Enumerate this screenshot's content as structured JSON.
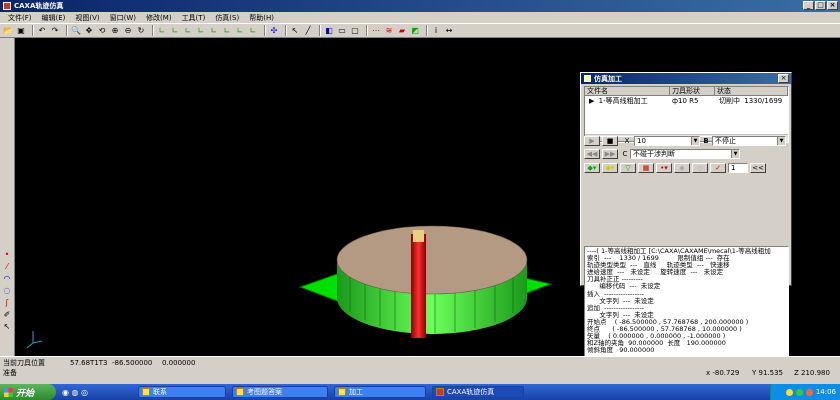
{
  "window": {
    "title": "CAXA轨迹仿真",
    "btn_min": "_",
    "btn_max": "□",
    "btn_close": "×"
  },
  "menu": [
    "文件(F)",
    "编辑(E)",
    "视图(V)",
    "窗口(W)",
    "修改(M)",
    "工具(T)",
    "仿真(S)",
    "帮助(H)"
  ],
  "sim_panel": {
    "title": "仿真加工",
    "close": "×",
    "columns": [
      "文件名",
      "刀具形状",
      "状态"
    ],
    "row": {
      "name": "1-等高线粗加工",
      "tool": "ф10 R5",
      "status": "切削中",
      "progress": "1330/1699"
    },
    "x_label": "X",
    "x_value": "10",
    "b_label": "B",
    "b_value": "不停止",
    "c_label": "C",
    "c_value": "不碰干涉判断",
    "interval_value": "1",
    "info_lines": [
      "----( 1-等高线粗加工 [C:\\CAXA\\CAXAME\\mecal\\1-等高线粗加",
      "索引  ---    1330 / 1699         限制值组 ---  存在",
      "轨迹类型类型  ---   直线     轨迹类型  ---   快速移",
      "进给速度  ---   未设定     旋转速度  ---   未设定",
      "刀具补正正 ---------",
      "      编移代码  ---  未设定",
      "插入  -----------------",
      "      文字列  ---  未设定",
      "追加  -----------------",
      "      文字列  ---  未设定",
      "开始点    ( -86.500000 , 57.768768 , 200.000000 )",
      "终点      ( -86.500000 , 57.768768 , 10.000000 )",
      "矢量    ( 0.000000 , 0.000000 , -1.000000 )",
      "和Z轴的夹角  90.000000  长度   190.000000",
      "倾斜角度   90.000000"
    ]
  },
  "statusbar": {
    "label": "当前刀具位置",
    "x": "57.68T1T3",
    "y": "-86.500000",
    "z": "0.000000"
  },
  "hint": "准备",
  "coords": {
    "x": "x   -80.729",
    "y": "Y   91.535",
    "z": "Z   210.980"
  },
  "taskbar": {
    "start": "开始",
    "tasks": [
      "联系",
      "考图题答案",
      "加工",
      "CAXA轨迹仿真"
    ],
    "clock": "14:06"
  },
  "colors": {
    "viewport": "#000000",
    "workpiece_top": "#b49a82",
    "base": "#00e000",
    "tool": "#d81010"
  }
}
